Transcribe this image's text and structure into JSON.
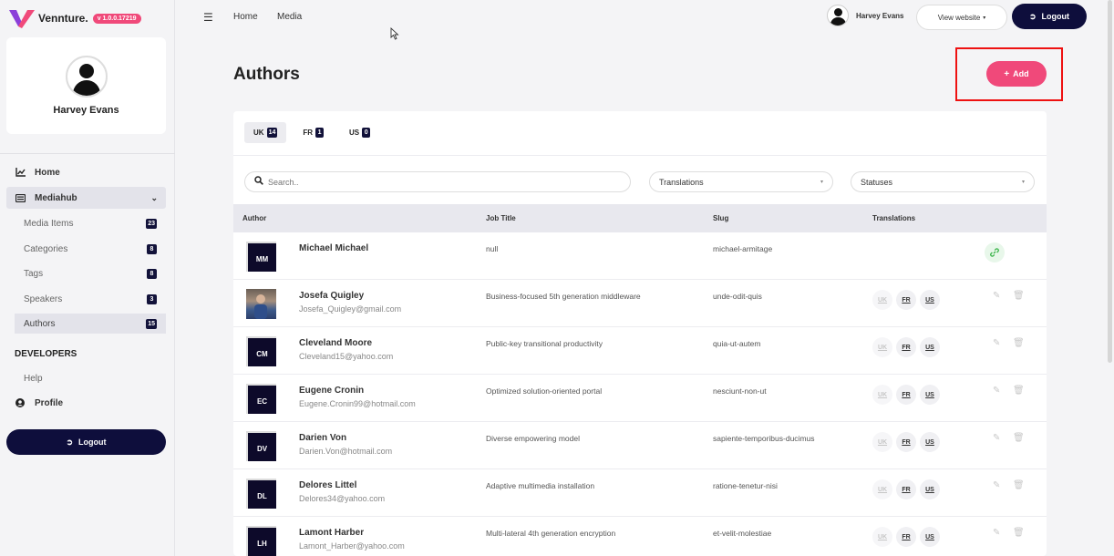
{
  "brand": {
    "name": "Vennture.",
    "version": "v 1.0.0.17219",
    "accent": "#f0497a",
    "dark": "#0e0e3c"
  },
  "sidebar": {
    "user_name": "Harvey Evans",
    "nav": {
      "home": "Home",
      "mediahub": "Mediahub",
      "profile": "Profile",
      "help": "Help"
    },
    "sub_items": [
      {
        "label": "Media Items",
        "count": "23"
      },
      {
        "label": "Categories",
        "count": "8"
      },
      {
        "label": "Tags",
        "count": "8"
      },
      {
        "label": "Speakers",
        "count": "3"
      },
      {
        "label": "Authors",
        "count": "15"
      }
    ],
    "section_developers": "DEVELOPERS",
    "logout": "Logout"
  },
  "topbar": {
    "breadcrumbs": [
      "Home",
      "Media"
    ],
    "user_name": "Harvey Evans",
    "view_website": "View website",
    "logout": "Logout"
  },
  "page": {
    "title": "Authors",
    "add_label": "Add"
  },
  "tabs": [
    {
      "label": "UK",
      "count": "14"
    },
    {
      "label": "FR",
      "count": "1"
    },
    {
      "label": "US",
      "count": "0"
    }
  ],
  "filters": {
    "search_placeholder": "Search..",
    "translations": "Translations",
    "statuses": "Statuses"
  },
  "table": {
    "headers": {
      "author": "Author",
      "job_title": "Job Title",
      "slug": "Slug",
      "translations": "Translations"
    },
    "rows": [
      {
        "initials": "MM",
        "name": "Michael Michael",
        "email": "",
        "job": "null",
        "slug": "michael-armitage"
      },
      {
        "initials": "",
        "name": "Josefa Quigley",
        "email": "Josefa_Quigley@gmail.com",
        "job": "Business-focused 5th generation middleware",
        "slug": "unde-odit-quis"
      },
      {
        "initials": "CM",
        "name": "Cleveland Moore",
        "email": "Cleveland15@yahoo.com",
        "job": "Public-key transitional productivity",
        "slug": "quia-ut-autem"
      },
      {
        "initials": "EC",
        "name": "Eugene Cronin",
        "email": "Eugene.Cronin99@hotmail.com",
        "job": "Optimized solution-oriented portal",
        "slug": "nesciunt-non-ut"
      },
      {
        "initials": "DV",
        "name": "Darien Von",
        "email": "Darien.Von@hotmail.com",
        "job": "Diverse empowering model",
        "slug": "sapiente-temporibus-ducimus"
      },
      {
        "initials": "DL",
        "name": "Delores Littel",
        "email": "Delores34@yahoo.com",
        "job": "Adaptive multimedia installation",
        "slug": "ratione-tenetur-nisi"
      },
      {
        "initials": "LH",
        "name": "Lamont Harber",
        "email": "Lamont_Harber@yahoo.com",
        "job": "Multi-lateral 4th generation encryption",
        "slug": "et-velit-molestiae"
      }
    ],
    "lang_labels": [
      "UK",
      "FR",
      "US"
    ]
  }
}
